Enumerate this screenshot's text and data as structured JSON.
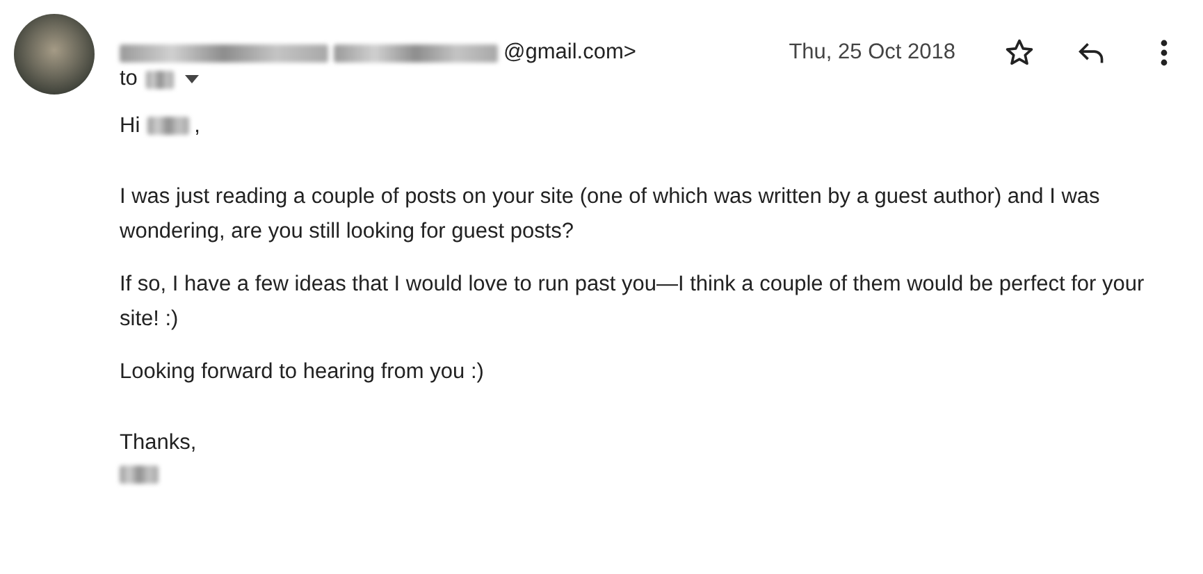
{
  "sender": {
    "email_end": "@gmail.com>",
    "date": "Thu, 25 Oct 2018",
    "to_label": "to"
  },
  "body": {
    "greeting": "Hi",
    "greeting_end": ",",
    "paragraphs": [
      "I was just reading a couple of posts on your site (one of which was written by a guest author) and I was wondering, are you still looking for guest posts?",
      "If so, I have a few ideas that I would love to run past you—I think a couple of them would be perfect for your site! :)",
      "Looking forward to hearing from you :)"
    ],
    "signoff": "Thanks,"
  }
}
